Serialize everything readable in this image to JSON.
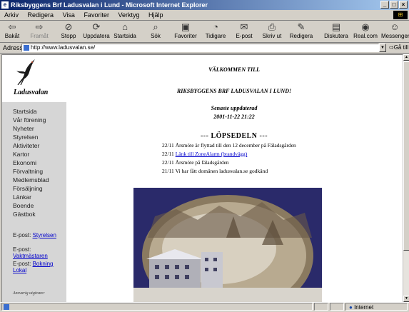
{
  "window": {
    "title": "Riksbyggens Brf Ladusvalan i Lund - Microsoft Internet Explorer"
  },
  "menu": [
    "Arkiv",
    "Redigera",
    "Visa",
    "Favoriter",
    "Verktyg",
    "Hjälp"
  ],
  "toolbar": {
    "back": "Bakåt",
    "forward": "Framåt",
    "stop": "Stopp",
    "refresh": "Uppdatera",
    "home": "Startsida",
    "search": "Sök",
    "favorites": "Favoriter",
    "history": "Tidigare",
    "mail": "E-post",
    "print": "Skriv ut",
    "edit": "Redigera",
    "discuss": "Diskutera",
    "realcom": "Real.com",
    "messenger": "Messenger"
  },
  "address": {
    "label": "Adress",
    "url": "http://www.ladusvalan.se/",
    "go": "Gå till"
  },
  "status": {
    "zone": "Internet"
  },
  "sidebar": {
    "brand": "Ladusvalan",
    "nav": [
      "Startsida",
      "Vår förening",
      "Nyheter",
      "Styrelsen",
      "Aktiviteter",
      "Kartor",
      "Ekonomi",
      "Förvaltning",
      "Medlemsblad",
      "Försäljning",
      "Länkar",
      "Boende",
      "Gästbok"
    ],
    "emails": [
      {
        "prefix": "E-post:",
        "link": "Styrelsen"
      },
      {
        "prefix": "E-post:",
        "link": "Vaktmästaren"
      },
      {
        "prefix": "E-post:",
        "link_line1": "Bokning",
        "link_line2": "Lokal"
      }
    ],
    "footnote": "Ansvarig utgivare:"
  },
  "content": {
    "welcome": "VÄLKOMMEN TILL",
    "org": "RIKSBYGGENS BRF LADUSVALAN I LUND!",
    "updated_label": "Senaste uppdaterad",
    "updated_value": "2001-11-22 21:22",
    "news_heading": "--- LÖPSEDELN ---",
    "news": [
      {
        "date": "22/11",
        "text": "Årsmöte är flyttad till den 12 december på Fäladsgården",
        "link": ""
      },
      {
        "date": "22/11",
        "text": "",
        "link": "Länk till ZoneAlarm (brandvägg)"
      },
      {
        "date": "22/11",
        "text": "Årsmöte på fäladsgården",
        "link": ""
      },
      {
        "date": "21/11",
        "text": "Vi har fått domänen ladusvalan.se godkänd",
        "link": ""
      }
    ]
  },
  "colors": {
    "titlebar_start": "#0a246a",
    "titlebar_end": "#a6caf0",
    "nav_bg": "#d6d6d6",
    "link": "#0000cc",
    "photo_frame": "#2a2a6a"
  },
  "icons": [
    "ie-icon",
    "back-icon",
    "forward-icon",
    "stop-icon",
    "refresh-icon",
    "home-icon",
    "search-icon",
    "favorites-icon",
    "history-icon",
    "mail-icon",
    "print-icon",
    "edit-icon",
    "discuss-icon",
    "realcom-icon",
    "messenger-icon",
    "swallow-logo-icon",
    "internet-zone-icon"
  ]
}
